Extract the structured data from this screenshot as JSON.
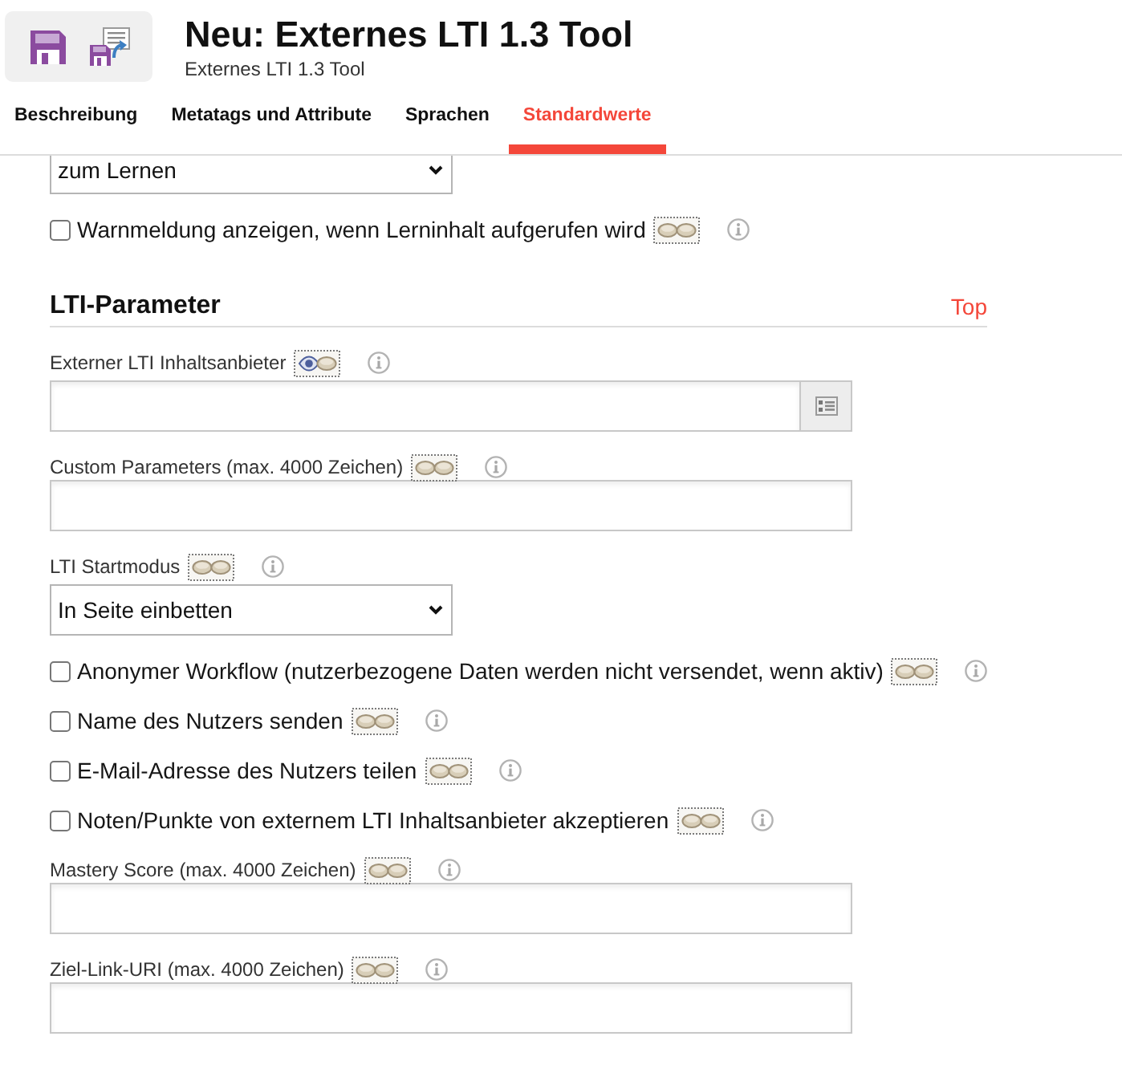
{
  "header": {
    "title": "Neu: Externes LTI 1.3 Tool",
    "subtitle": "Externes LTI 1.3 Tool"
  },
  "tabs": [
    {
      "label": "Beschreibung",
      "selected": false
    },
    {
      "label": "Metatags und Attribute",
      "selected": false
    },
    {
      "label": "Sprachen",
      "selected": false
    },
    {
      "label": "Standardwerte",
      "selected": true
    }
  ],
  "form": [
    {
      "kind": "select",
      "value": "zum Lernen"
    },
    {
      "kind": "checkbox",
      "label": "Warnmeldung anzeigen, wenn Lerninhalt aufgerufen wird",
      "checked": false,
      "eye_open": false
    },
    {
      "kind": "section",
      "title": "LTI-Parameter",
      "link": "Top"
    },
    {
      "kind": "picker",
      "label": "Externer LTI Inhaltsanbieter",
      "eye_open": true
    },
    {
      "kind": "text",
      "label": "Custom Parameters (max. 4000 Zeichen)",
      "eye_open": false
    },
    {
      "kind": "select",
      "label": "LTI Startmodus",
      "value": "In Seite einbetten",
      "eye_open": false
    },
    {
      "kind": "checkbox",
      "label": "Anonymer Workflow (nutzerbezogene Daten werden nicht versendet, wenn aktiv)",
      "checked": false,
      "eye_open": false
    },
    {
      "kind": "checkbox",
      "label": "Name des Nutzers senden",
      "checked": false,
      "eye_open": false
    },
    {
      "kind": "checkbox",
      "label": "E-Mail-Adresse des Nutzers teilen",
      "checked": false,
      "eye_open": false
    },
    {
      "kind": "checkbox",
      "label": "Noten/Punkte von externem LTI Inhaltsanbieter akzeptieren",
      "checked": false,
      "eye_open": false
    },
    {
      "kind": "text",
      "label": "Mastery Score (max. 4000 Zeichen)",
      "eye_open": false
    },
    {
      "kind": "text",
      "label": "Ziel-Link-URI (max. 4000 Zeichen)",
      "eye_open": false
    }
  ]
}
